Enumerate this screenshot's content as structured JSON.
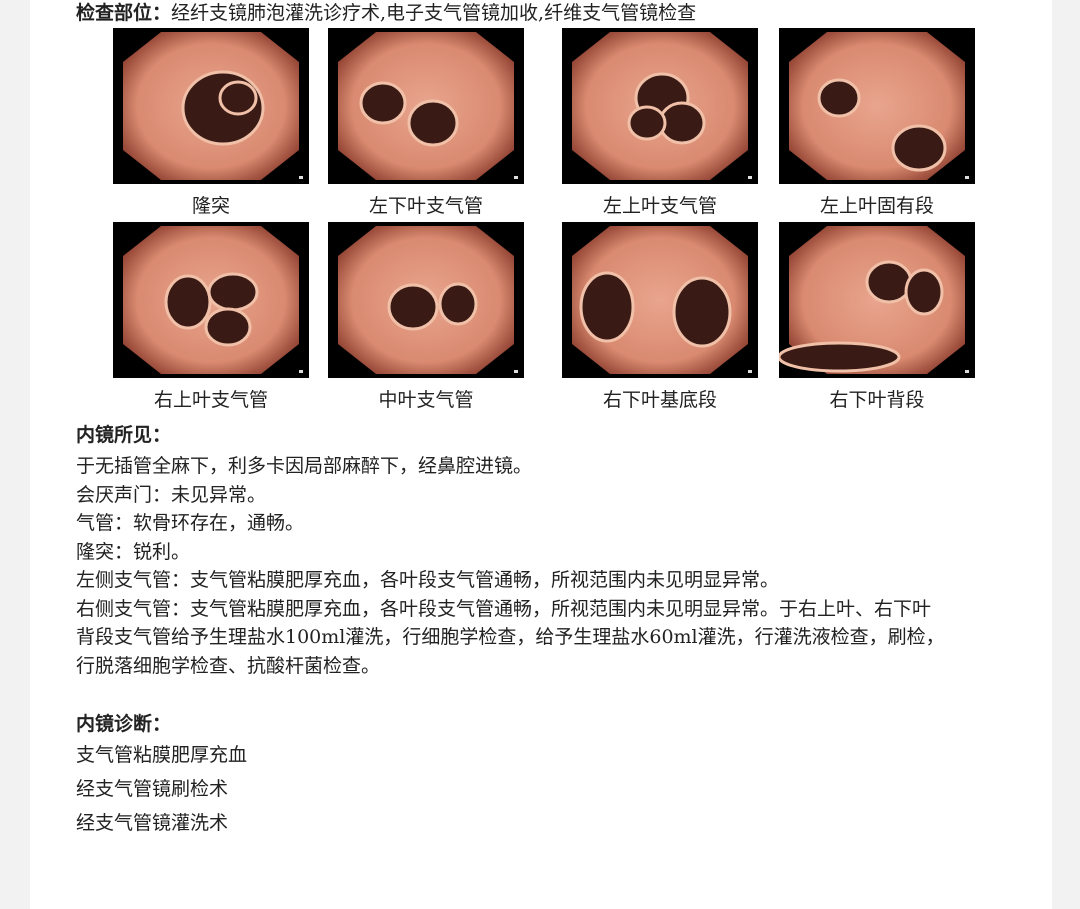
{
  "exam": {
    "label": "检查部位：",
    "value": "经纤支镜肺泡灌洗诊疗术,电子支气管镜加收,纤维支气管镜检查"
  },
  "images": [
    {
      "caption": "隆突",
      "icon": "endoscopy-carina-image"
    },
    {
      "caption": "左下叶支气管",
      "icon": "endoscopy-bronchus-image"
    },
    {
      "caption": "左上叶支气管",
      "icon": "endoscopy-bronchus-image"
    },
    {
      "caption": "左上叶固有段",
      "icon": "endoscopy-bronchus-image"
    },
    {
      "caption": "右上叶支气管",
      "icon": "endoscopy-bronchus-image"
    },
    {
      "caption": "中叶支气管",
      "icon": "endoscopy-bronchus-image"
    },
    {
      "caption": "右下叶基底段",
      "icon": "endoscopy-bronchus-image"
    },
    {
      "caption": "右下叶背段",
      "icon": "endoscopy-bronchus-image"
    }
  ],
  "findings": {
    "title": "内镜所见：",
    "lines": [
      "于无插管全麻下，利多卡因局部麻醉下，经鼻腔进镜。",
      "会厌声门：未见异常。",
      "气管：软骨环存在，通畅。",
      "隆突：锐利。",
      "左侧支气管：支气管粘膜肥厚充血，各叶段支气管通畅，所视范围内未见明显异常。",
      "右侧支气管：支气管粘膜肥厚充血，各叶段支气管通畅，所视范围内未见明显异常。于右上叶、右下叶",
      "背段支气管给予生理盐水100ml灌洗，行细胞学检查，给予生理盐水60ml灌洗，行灌洗液检查，刷检，",
      "行脱落细胞学检查、抗酸杆菌检查。"
    ]
  },
  "diagnosis": {
    "title": "内镜诊断：",
    "lines": [
      "支气管粘膜肥厚充血",
      "经支气管镜刷检术",
      "经支气管镜灌洗术"
    ]
  },
  "colors": {
    "mucosa": "#d98a70",
    "mucosa_dark": "#8a3b2c",
    "lumen": "#3a1a14",
    "frame": "#000000"
  }
}
